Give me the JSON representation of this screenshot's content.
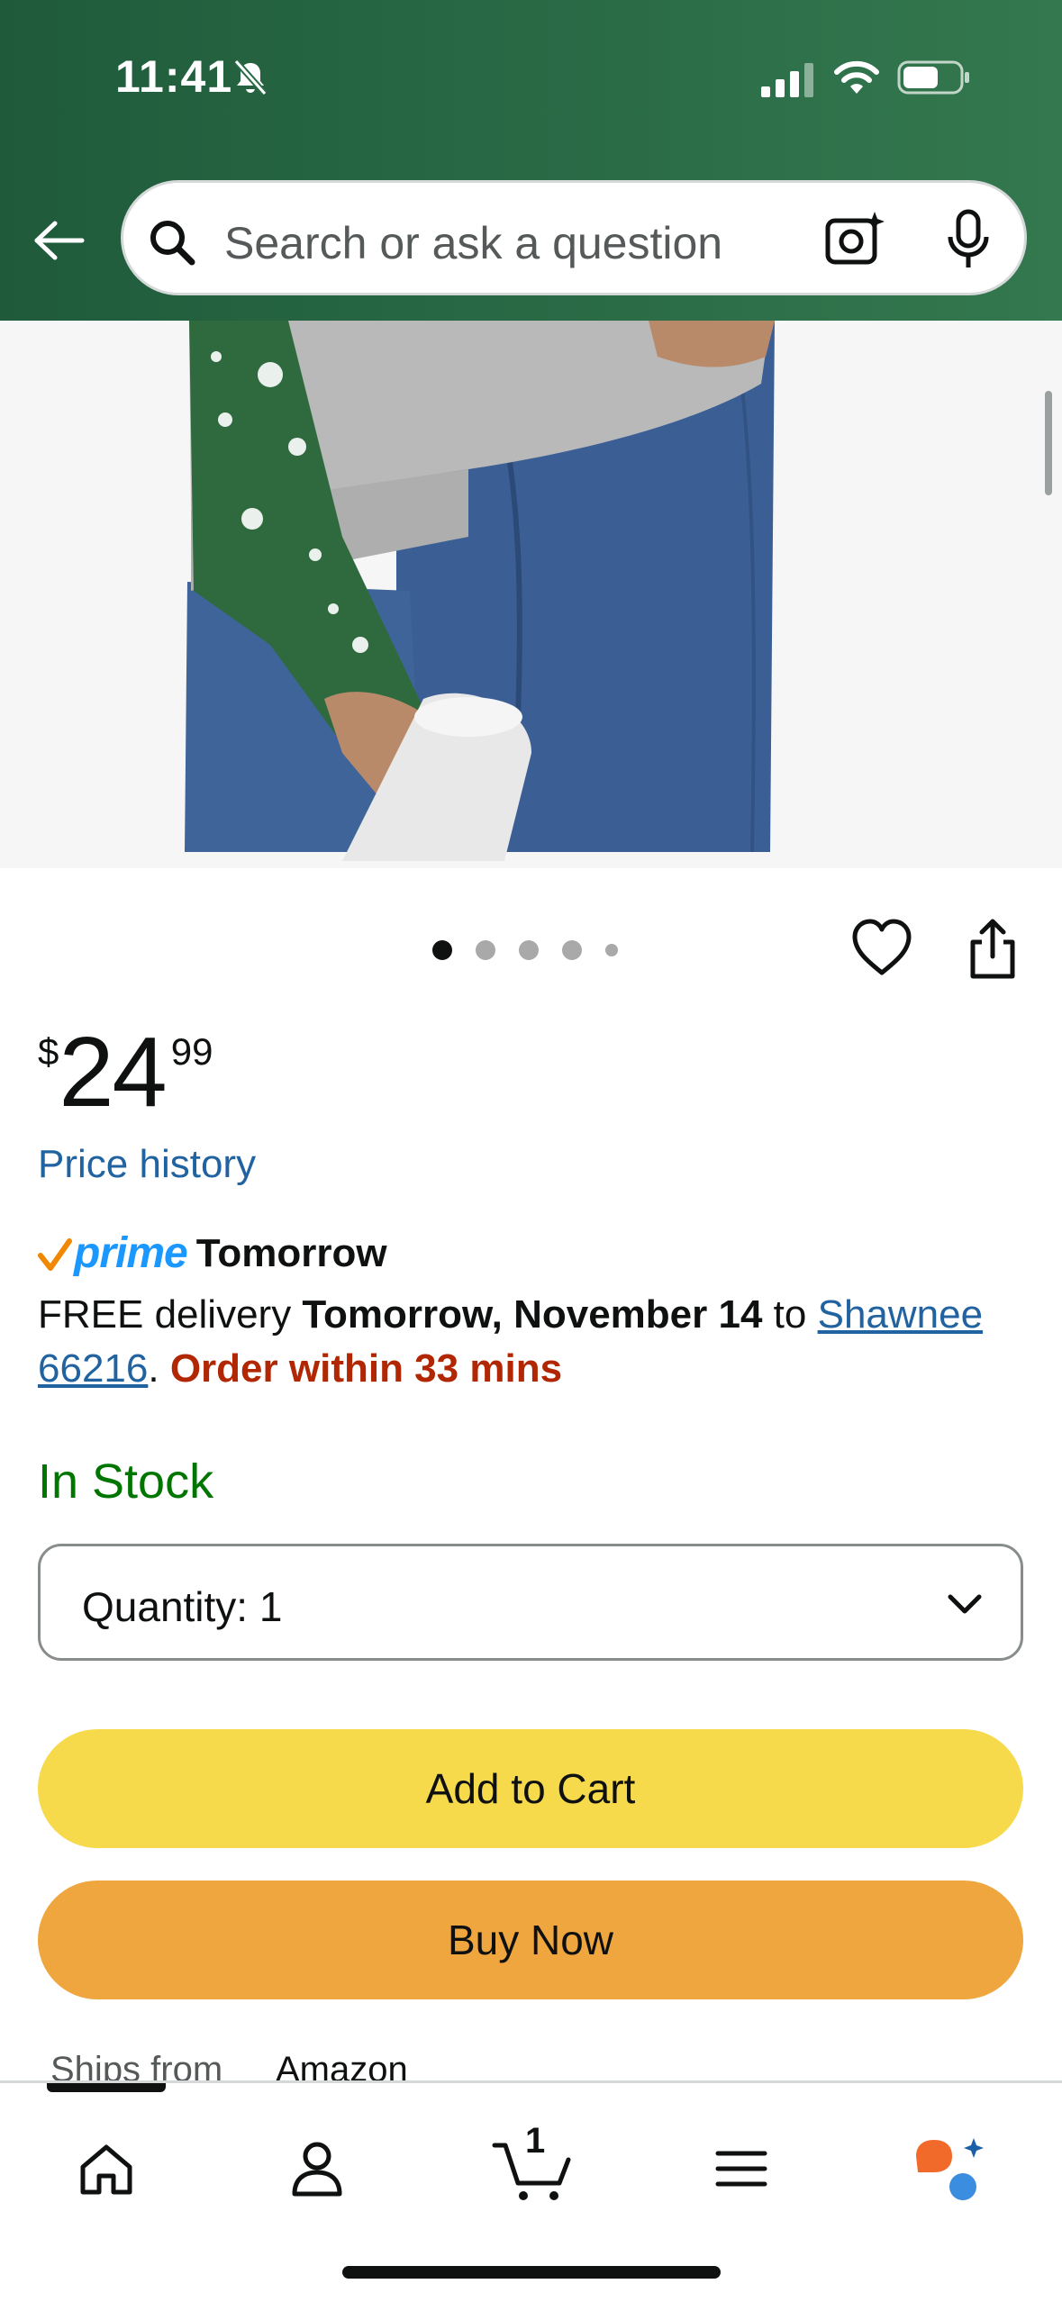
{
  "status_bar": {
    "time": "11:41",
    "icons": [
      "bell-off-icon",
      "cellular-signal-icon",
      "wifi-icon",
      "battery-icon"
    ]
  },
  "header": {
    "back_icon": "back-arrow-icon",
    "search": {
      "placeholder": "Search or ask a question",
      "icons": [
        "search-icon",
        "camera-search-icon",
        "microphone-icon"
      ]
    }
  },
  "product": {
    "image_dots": {
      "count": 5,
      "active_index": 0
    },
    "actions": [
      "heart-icon",
      "share-icon"
    ],
    "price": {
      "symbol": "$",
      "whole": "24",
      "fraction": "99"
    },
    "price_history_link": "Price history",
    "prime": {
      "word": "prime",
      "label": "Tomorrow"
    },
    "delivery": {
      "prefix": "FREE delivery",
      "date": "Tomorrow, November 14",
      "to_text": "to",
      "location": "Shawnee 66216",
      "period": ".",
      "urgency": "Order within 33 mins"
    },
    "stock_status": "In Stock",
    "quantity": {
      "label": "Quantity:",
      "value": "1"
    },
    "add_to_cart_label": "Add to Cart",
    "buy_now_label": "Buy Now",
    "ships_from": {
      "label": "Ships from",
      "value": "Amazon"
    }
  },
  "bottom_nav": {
    "items": [
      "home-icon",
      "account-icon",
      "cart-icon",
      "menu-icon",
      "rufus-ai-icon"
    ],
    "cart_count": "1"
  },
  "colors": {
    "header_green": "#2a6b46",
    "link_blue": "#2162a1",
    "in_stock_green": "#007600",
    "urgent_red": "#b12704",
    "add_to_cart_yellow": "#f6da4b",
    "buy_now_orange": "#f0a63e",
    "prime_blue": "#1a98ff"
  }
}
